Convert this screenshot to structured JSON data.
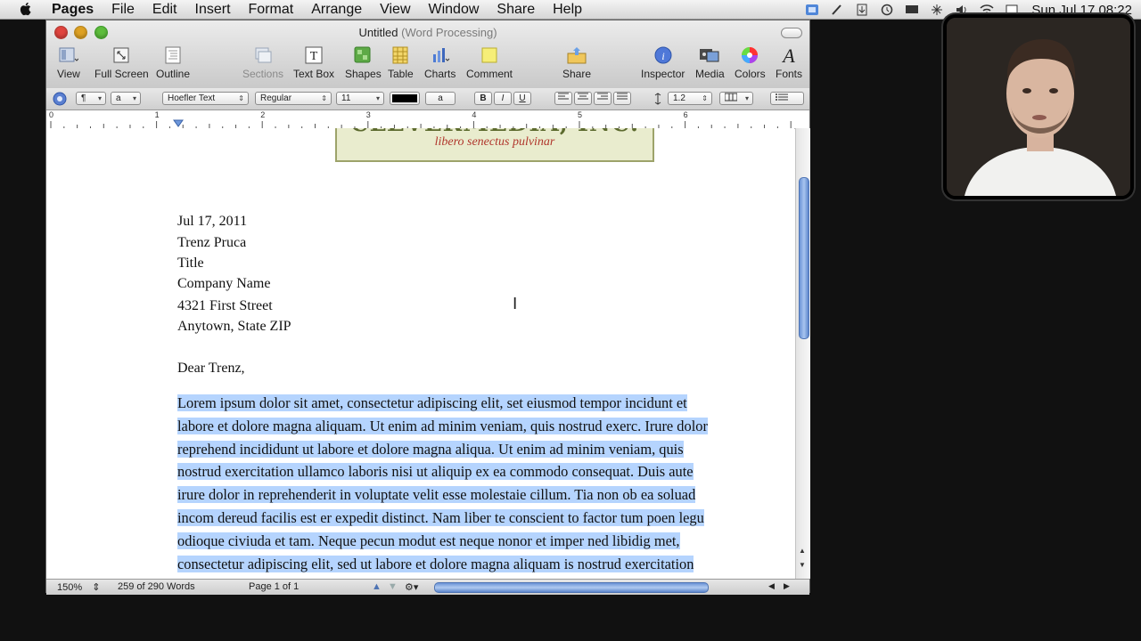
{
  "menubar": {
    "app_name": "Pages",
    "items": [
      "File",
      "Edit",
      "Insert",
      "Format",
      "Arrange",
      "View",
      "Window",
      "Share",
      "Help"
    ],
    "clock": "Sun Jul 17 08:22"
  },
  "window": {
    "title": "Untitled",
    "title_suffix": "(Word Processing)"
  },
  "toolbar": {
    "view": "View",
    "full_screen": "Full Screen",
    "outline": "Outline",
    "sections": "Sections",
    "text_box": "Text Box",
    "shapes": "Shapes",
    "table": "Table",
    "charts": "Charts",
    "comment": "Comment",
    "share": "Share",
    "inspector": "Inspector",
    "media": "Media",
    "colors": "Colors",
    "fonts": "Fonts"
  },
  "formatbar": {
    "paragraph_style": "¶",
    "char_style": "a",
    "font_family": "Hoefler Text",
    "font_style": "Regular",
    "font_size": "11",
    "text_color": "#000000",
    "highlight_label": "a",
    "bold": "B",
    "italic": "I",
    "underline": "U",
    "line_spacing": "1.2"
  },
  "ruler": {
    "numbers": [
      "0",
      "1",
      "2",
      "3",
      "4",
      "5",
      "6"
    ]
  },
  "document": {
    "logo_company": "CLEVERMEDIA, INC.",
    "logo_tagline": "libero senectus pulvinar",
    "address": {
      "date": "Jul 17, 2011",
      "name": "Trenz Pruca",
      "title": "Title",
      "company": "Company Name",
      "street": "4321 First Street",
      "city": "Anytown, State ZIP"
    },
    "salutation": "Dear Trenz,",
    "body_lines": [
      "Lorem ipsum dolor sit amet, consectetur adipiscing elit, set eiusmod tempor incidunt et",
      "labore et dolore magna aliquam. Ut enim ad minim veniam, quis nostrud exerc. Irure dolor",
      "reprehend incididunt ut labore et dolore magna aliqua. Ut enim ad minim veniam, quis",
      "nostrud exercitation ullamco laboris nisi ut aliquip ex ea commodo consequat. Duis aute",
      "irure dolor in reprehenderit in voluptate velit esse molestaie cillum. Tia non ob ea soluad",
      "incom dereud facilis est er expedit distinct. Nam liber te conscient to factor tum poen legu",
      "odioque civiuda et tam. Neque pecun modut est neque nonor et imper ned libidig met,",
      "consectetur adipiscing elit, sed ut labore et dolore magna aliquam is nostrud exercitation"
    ],
    "selection_color": "#b5d4fe"
  },
  "statusbar": {
    "zoom": "150%",
    "word_count": "259 of 290 Words",
    "page": "Page 1 of 1"
  }
}
